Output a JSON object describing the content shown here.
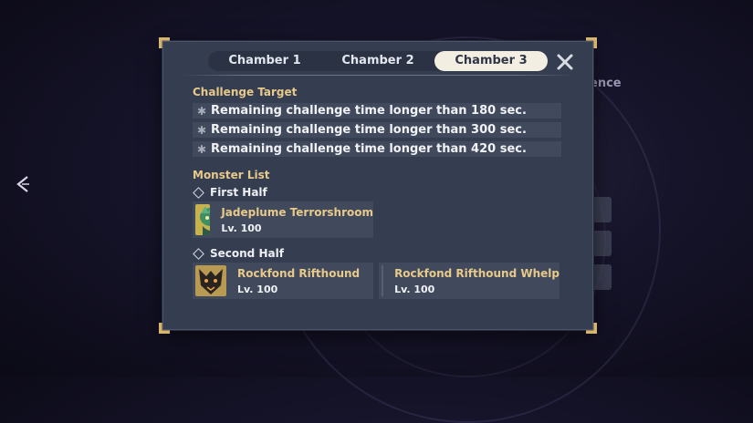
{
  "background": {
    "fragment_text": "ence"
  },
  "tabs": [
    {
      "label": "Chamber 1",
      "active": false
    },
    {
      "label": "Chamber 2",
      "active": false
    },
    {
      "label": "Chamber 3",
      "active": true
    }
  ],
  "challenge": {
    "title": "Challenge Target",
    "targets": [
      "Remaining challenge time longer than 180 sec.",
      "Remaining challenge time longer than 300 sec.",
      "Remaining challenge time longer than 420 sec."
    ]
  },
  "monsters": {
    "title": "Monster List",
    "first_half": {
      "label": "First Half",
      "items": [
        {
          "name": "Jadeplume Terrorshroom",
          "level": "Lv. 100",
          "icon": "jadeplume-terrorshroom-portrait"
        }
      ]
    },
    "second_half": {
      "label": "Second Half",
      "items": [
        {
          "name": "Rockfond Rifthound",
          "level": "Lv. 100",
          "icon": "rockfond-rifthound-portrait"
        },
        {
          "name": "Rockfond Rifthound Whelp",
          "level": "Lv. 100",
          "icon": "rockfond-rifthound-whelp-portrait"
        }
      ]
    }
  },
  "colors": {
    "panel": "#353d50",
    "accent_gold": "#e7c98a",
    "active_tab": "#f2eee2"
  }
}
